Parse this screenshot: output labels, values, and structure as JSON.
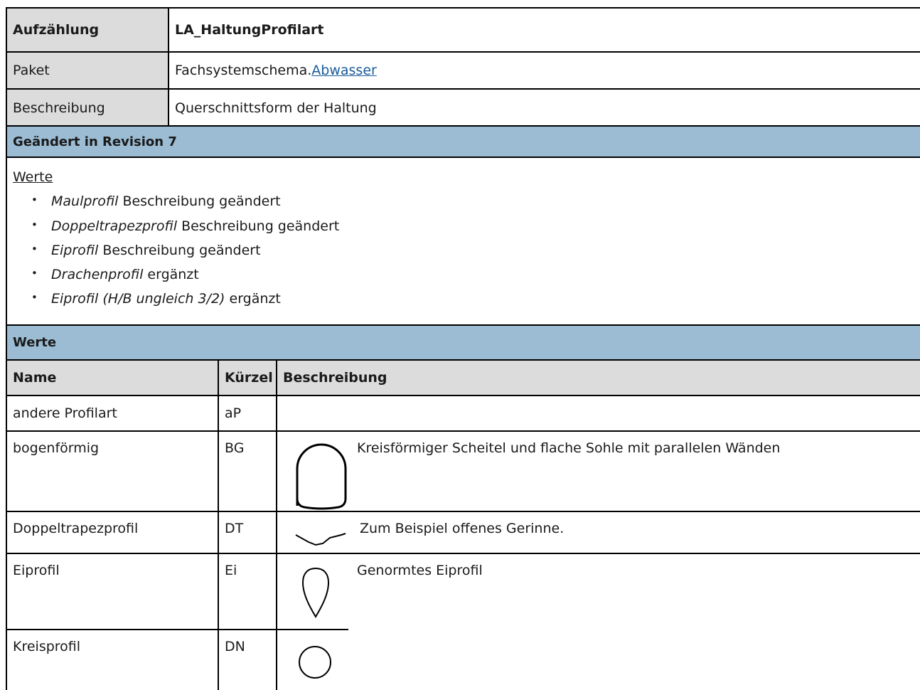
{
  "info": {
    "aufzaehlung_label": "Aufzählung",
    "aufzaehlung_value": "LA_HaltungProfilart",
    "paket_label": "Paket",
    "paket_prefix": "Fachsystemschema.",
    "paket_link": "Abwasser",
    "beschreibung_label": "Beschreibung",
    "beschreibung_value": "Querschnittsform der Haltung"
  },
  "revision": {
    "heading": "Geändert in Revision 7",
    "werte_link": "Werte",
    "items": [
      {
        "name": "Maulprofil",
        "text": " Beschreibung geändert"
      },
      {
        "name": "Doppeltrapezprofil",
        "text": " Beschreibung geändert"
      },
      {
        "name": "Eiprofil",
        "text": " Beschreibung geändert"
      },
      {
        "name": "Drachenprofil",
        "text": " ergänzt"
      },
      {
        "name": "Eiprofil (H/B ungleich 3/2)",
        "text": " ergänzt"
      }
    ],
    "bullet": "•"
  },
  "werte": {
    "heading": "Werte",
    "columns": [
      "Name",
      "Kürzel",
      "Beschreibung"
    ],
    "rows": [
      {
        "name": "andere Profilart",
        "code": "aP",
        "desc": "",
        "icon": "none"
      },
      {
        "name": "bogenförmig",
        "code": "BG",
        "desc": "Kreisförmiger Scheitel und flache Sohle mit parallelen Wänden",
        "icon": "arch-profile-icon"
      },
      {
        "name": "Doppeltrapezprofil",
        "code": "DT",
        "desc": "Zum Beispiel offenes Gerinne.",
        "icon": "double-trapezoid-profile-icon"
      },
      {
        "name": "Eiprofil",
        "code": "Ei",
        "desc": "Genormtes Eiprofil",
        "icon": "egg-profile-icon"
      },
      {
        "name": "Kreisprofil",
        "code": "DN",
        "desc": "",
        "icon": "circle-profile-icon"
      }
    ]
  }
}
